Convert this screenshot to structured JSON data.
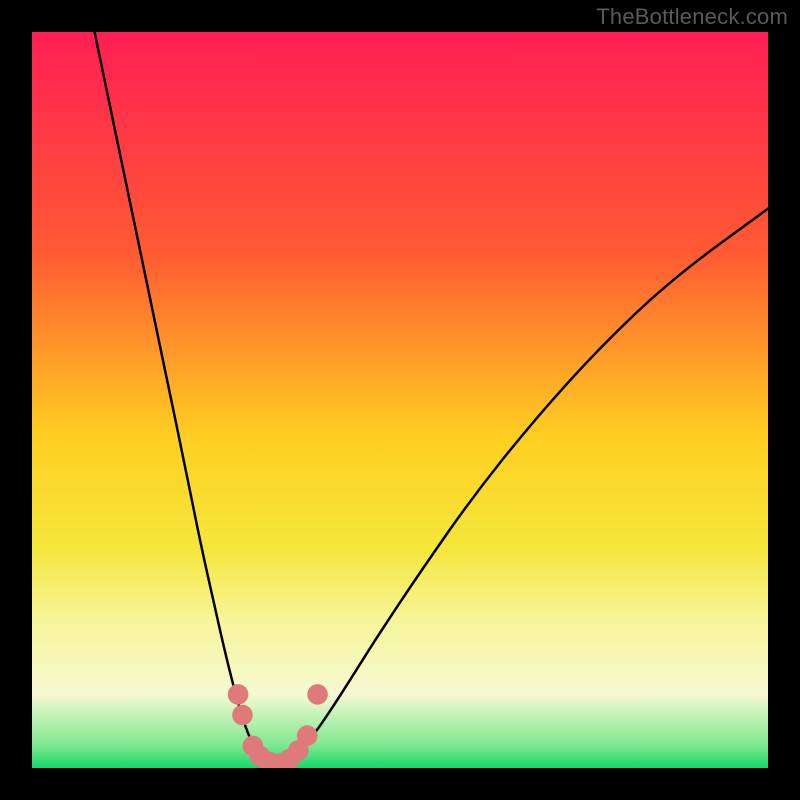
{
  "watermark": "TheBottleneck.com",
  "chart_data": {
    "type": "line",
    "title": "",
    "xlabel": "",
    "ylabel": "",
    "xlim": [
      0,
      1
    ],
    "ylim": [
      0,
      1
    ],
    "background_gradient": {
      "stops": [
        {
          "offset": 0.0,
          "color": "#ff1e55"
        },
        {
          "offset": 0.3,
          "color": "#ff5a33"
        },
        {
          "offset": 0.55,
          "color": "#ffcf22"
        },
        {
          "offset": 0.7,
          "color": "#f5e63a"
        },
        {
          "offset": 0.8,
          "color": "#f7f59a"
        },
        {
          "offset": 0.9,
          "color": "#f4f9d2"
        },
        {
          "offset": 0.97,
          "color": "#7be88f"
        },
        {
          "offset": 1.0,
          "color": "#15d96a"
        }
      ]
    },
    "series": [
      {
        "name": "left-branch",
        "color": "#000000",
        "points": [
          {
            "x": 0.085,
            "y": 1.0
          },
          {
            "x": 0.11,
            "y": 0.88
          },
          {
            "x": 0.135,
            "y": 0.76
          },
          {
            "x": 0.16,
            "y": 0.64
          },
          {
            "x": 0.185,
            "y": 0.52
          },
          {
            "x": 0.208,
            "y": 0.41
          },
          {
            "x": 0.228,
            "y": 0.31
          },
          {
            "x": 0.248,
            "y": 0.22
          },
          {
            "x": 0.264,
            "y": 0.15
          },
          {
            "x": 0.278,
            "y": 0.095
          },
          {
            "x": 0.29,
            "y": 0.055
          },
          {
            "x": 0.302,
            "y": 0.028
          },
          {
            "x": 0.315,
            "y": 0.012
          },
          {
            "x": 0.33,
            "y": 0.004
          }
        ]
      },
      {
        "name": "right-branch",
        "color": "#000000",
        "points": [
          {
            "x": 0.33,
            "y": 0.004
          },
          {
            "x": 0.35,
            "y": 0.01
          },
          {
            "x": 0.38,
            "y": 0.04
          },
          {
            "x": 0.42,
            "y": 0.1
          },
          {
            "x": 0.47,
            "y": 0.18
          },
          {
            "x": 0.53,
            "y": 0.27
          },
          {
            "x": 0.6,
            "y": 0.37
          },
          {
            "x": 0.68,
            "y": 0.47
          },
          {
            "x": 0.77,
            "y": 0.57
          },
          {
            "x": 0.87,
            "y": 0.665
          },
          {
            "x": 1.0,
            "y": 0.76
          }
        ]
      }
    ],
    "markers": {
      "name": "bottleneck-points",
      "color": "#e07a7a",
      "radius_norm": 0.014,
      "points": [
        {
          "x": 0.28,
          "y": 0.1
        },
        {
          "x": 0.286,
          "y": 0.072
        },
        {
          "x": 0.3,
          "y": 0.03
        },
        {
          "x": 0.31,
          "y": 0.016
        },
        {
          "x": 0.322,
          "y": 0.008
        },
        {
          "x": 0.336,
          "y": 0.006
        },
        {
          "x": 0.35,
          "y": 0.012
        },
        {
          "x": 0.362,
          "y": 0.024
        },
        {
          "x": 0.374,
          "y": 0.044
        },
        {
          "x": 0.388,
          "y": 0.1
        }
      ]
    }
  }
}
